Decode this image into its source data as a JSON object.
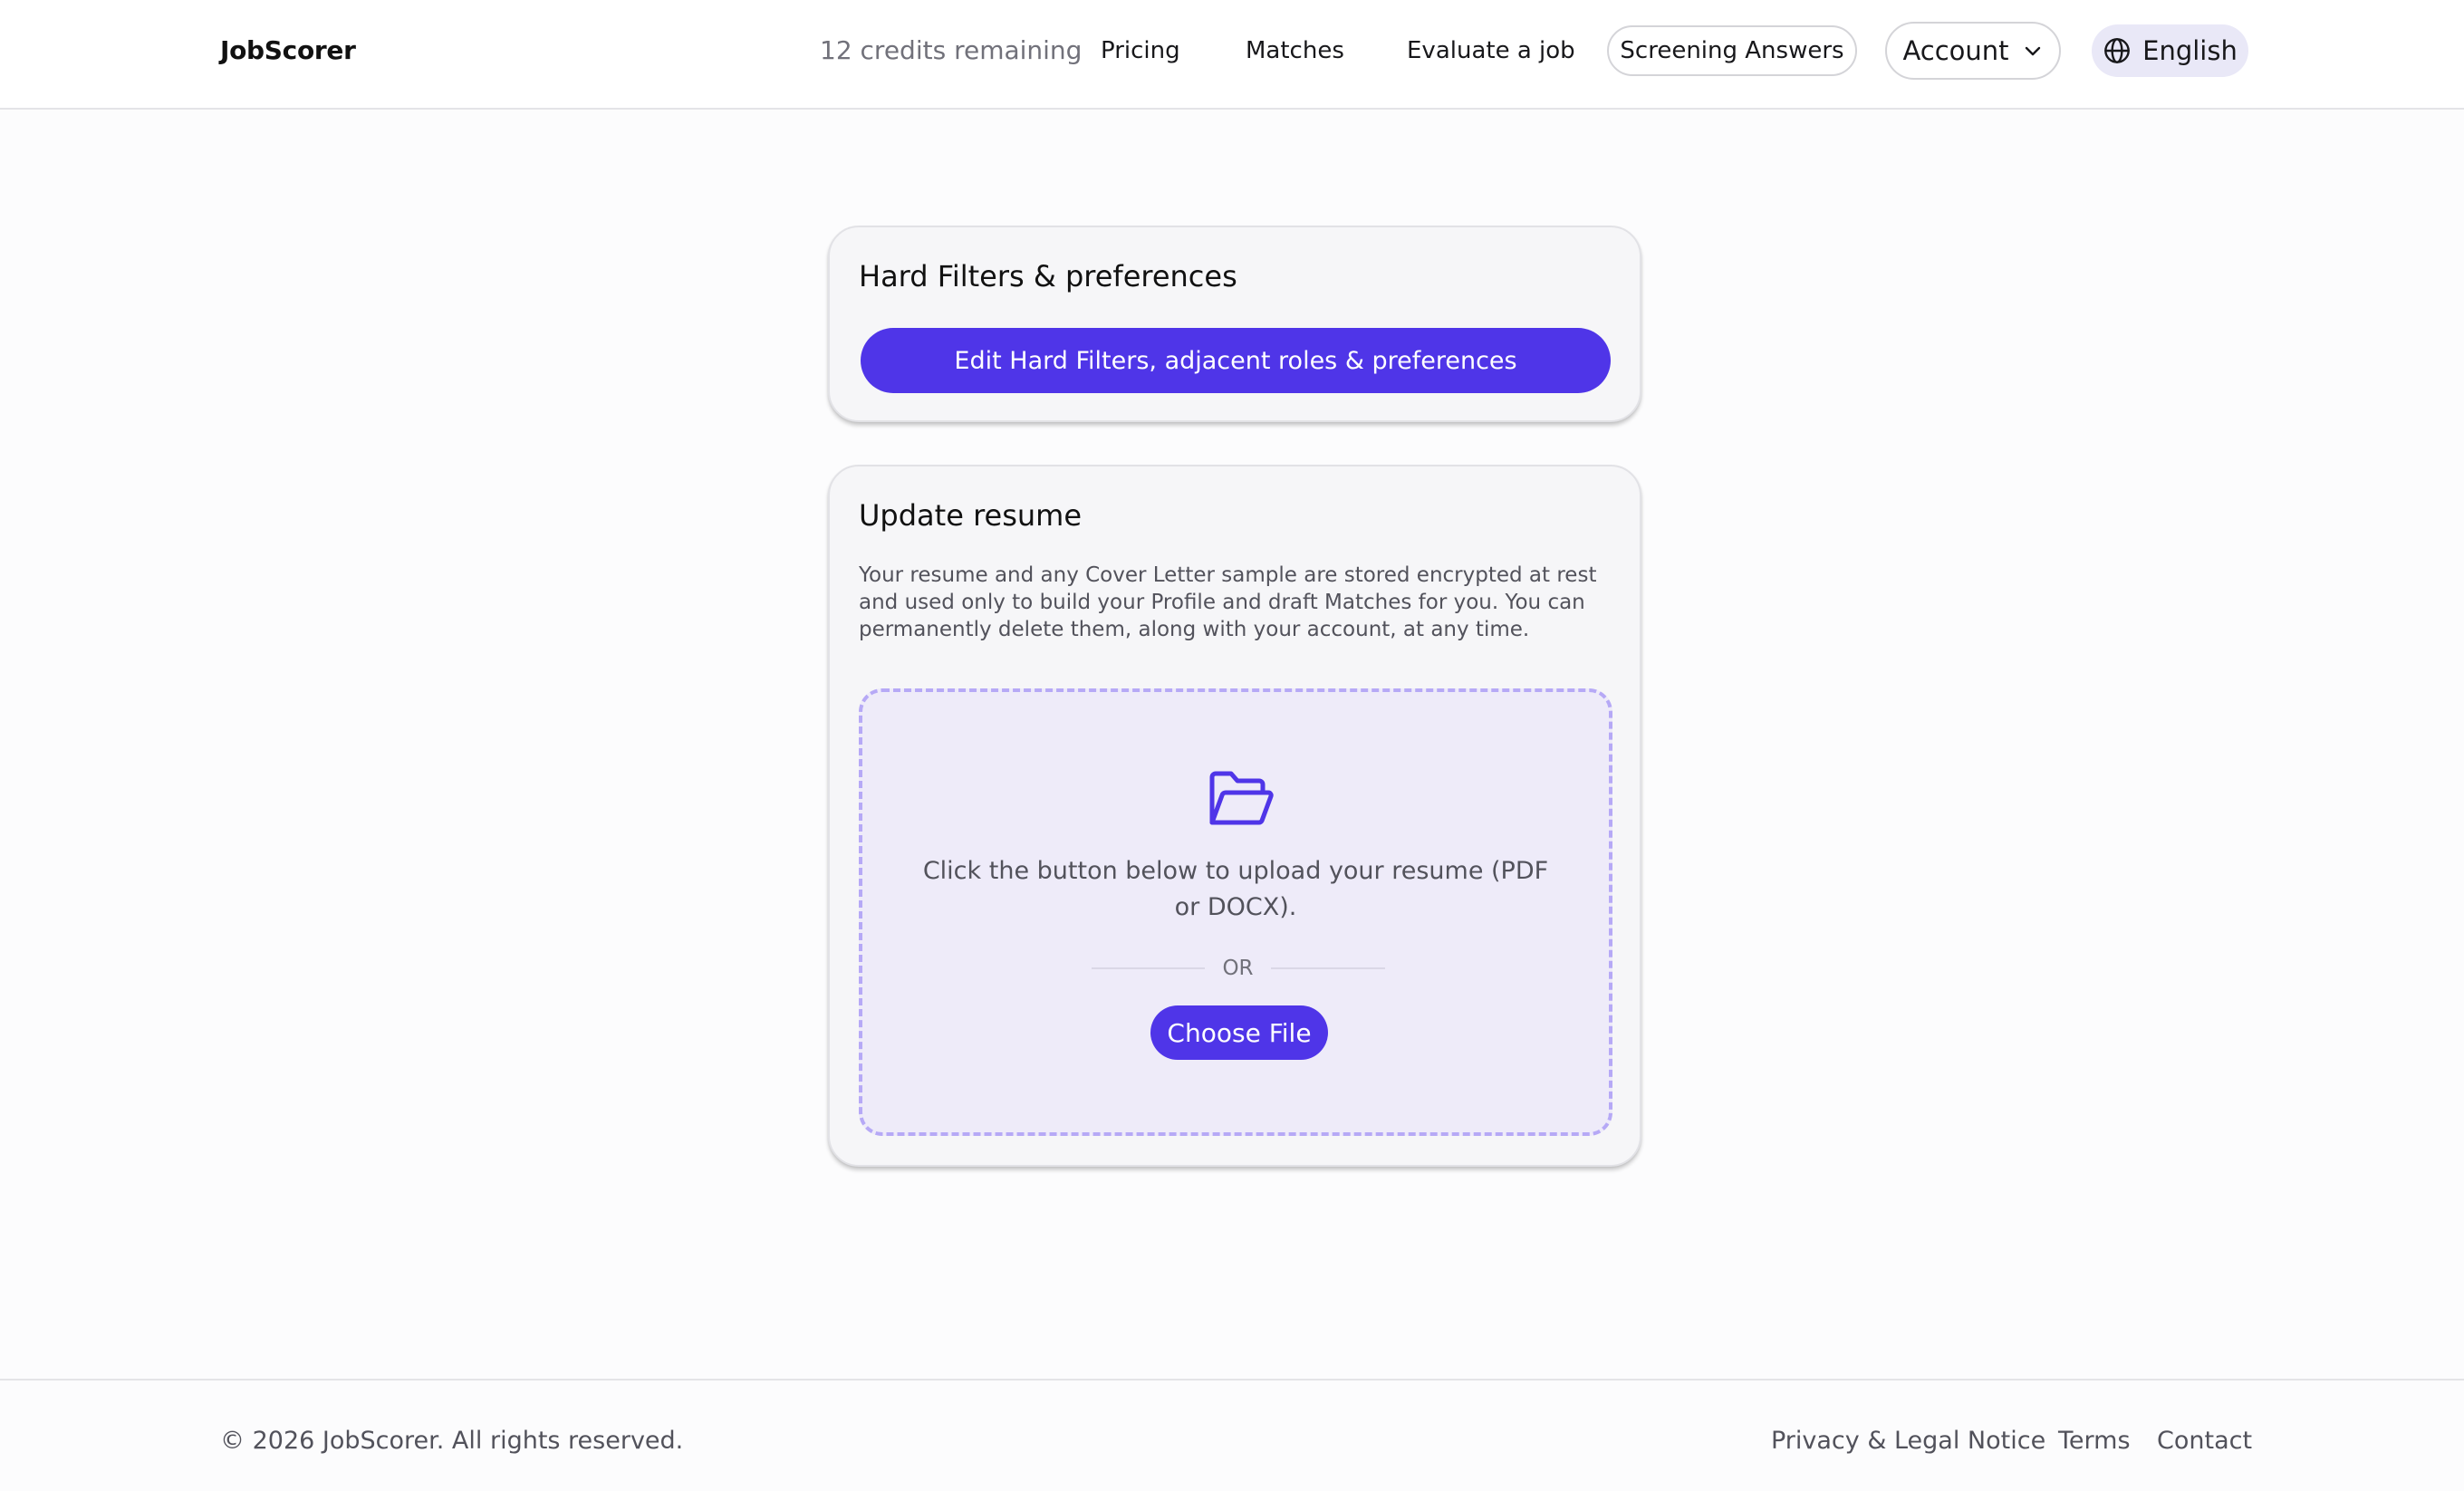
{
  "header": {
    "brand": "JobScorer",
    "credits": "12 credits remaining",
    "nav": {
      "pricing": "Pricing",
      "matches": "Matches",
      "evaluate": "Evaluate a job"
    },
    "screening_answers": "Screening Answers",
    "account": "Account",
    "account_icon": "chevron-down-icon",
    "language": "English",
    "language_icon": "globe-icon"
  },
  "filters_card": {
    "title": "Hard Filters & preferences",
    "edit_button": "Edit Hard Filters, adjacent roles & preferences"
  },
  "resume_card": {
    "title": "Update resume",
    "description": "Your resume and any Cover Letter sample are stored encrypted at rest and used only to build your Profile and draft Matches for you. You can permanently delete them, along with your account, at any time.",
    "dropzone": {
      "icon": "folder-open-icon",
      "instruction": "Click the button below to upload your resume (PDF or DOCX).",
      "or_label": "OR",
      "choose_button": "Choose File"
    }
  },
  "footer": {
    "copyright": "© 2026 JobScorer. All rights reserved.",
    "links": {
      "privacy": "Privacy & Legal Notice",
      "terms": "Terms",
      "contact": "Contact"
    }
  },
  "colors": {
    "accent": "#4f35e8",
    "dropzone_bg": "#eeebf9",
    "dropzone_border": "#b6a9f6",
    "language_bg": "#e9e8f7"
  }
}
